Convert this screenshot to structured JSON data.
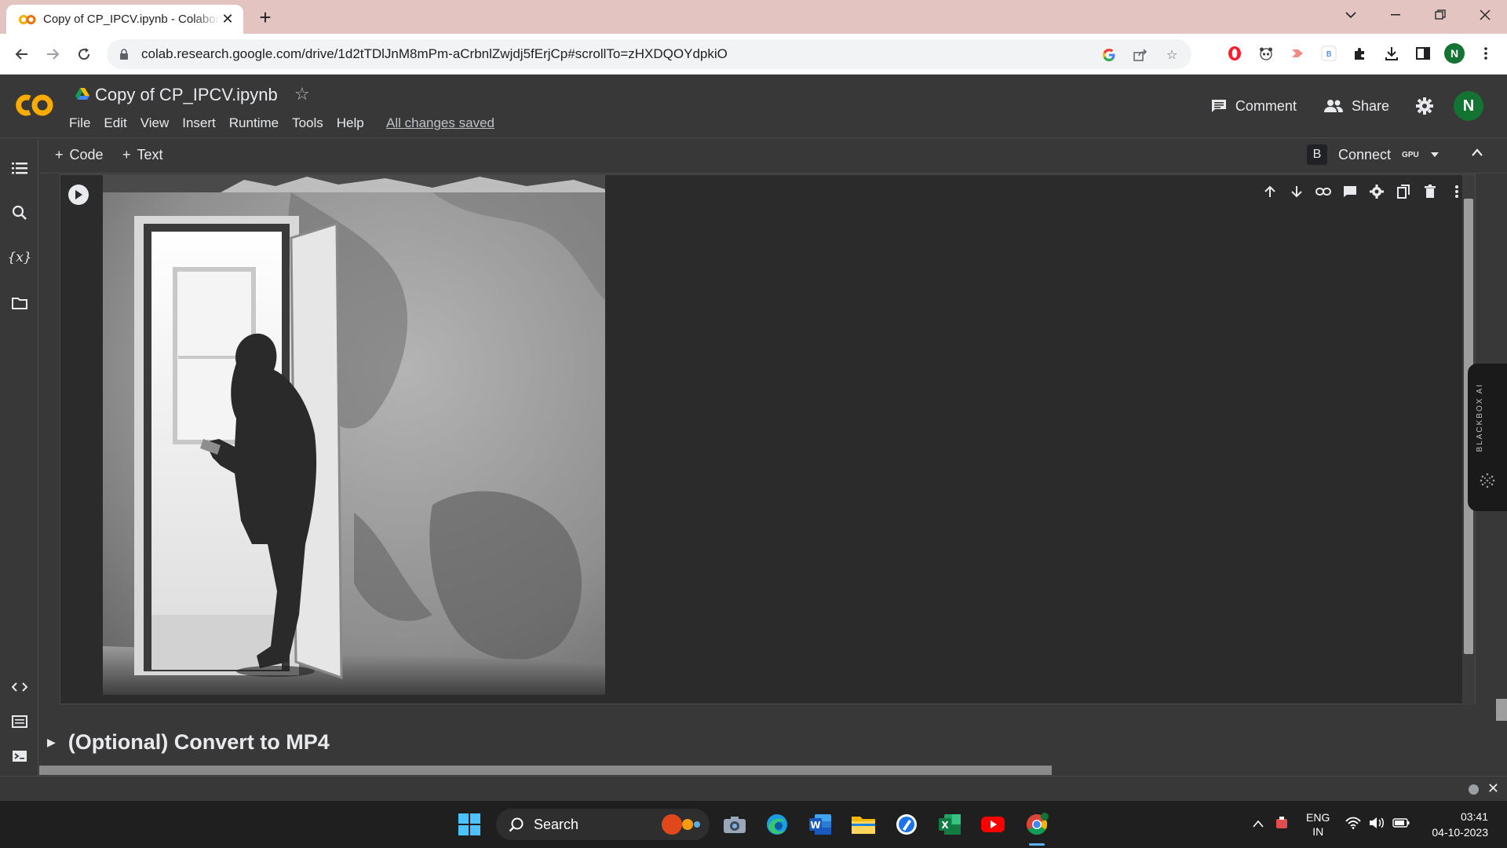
{
  "browser": {
    "tab_title": "Copy of CP_IPCV.ipynb - Colaboratory",
    "url": "colab.research.google.com/drive/1d2tTDlJnM8mPm-aCrbnlZwjdj5fErjCp#scrollTo=zHXDQOYdpkiO",
    "profile_initial": "N"
  },
  "colab": {
    "notebook_title": "Copy of CP_IPCV.ipynb",
    "menu": [
      "File",
      "Edit",
      "View",
      "Insert",
      "Runtime",
      "Tools",
      "Help"
    ],
    "save_status": "All changes saved",
    "comment_label": "Comment",
    "share_label": "Share",
    "avatar_initial": "N",
    "add_code_label": "Code",
    "add_text_label": "Text",
    "runtime_badge": "B",
    "connect_label": "Connect",
    "accelerator": "GPU",
    "section_title": "(Optional) Convert to MP4",
    "side_widget_label": "BLACKBOX AI"
  },
  "taskbar": {
    "search_label": "Search",
    "lang_line1": "ENG",
    "lang_line2": "IN",
    "time": "03:41",
    "date": "04-10-2023"
  },
  "colors": {
    "accent_orange": "#f9ab00",
    "colab_bg": "#383838",
    "tab_strip": "#e3c4c1",
    "avatar_green": "#137333"
  }
}
